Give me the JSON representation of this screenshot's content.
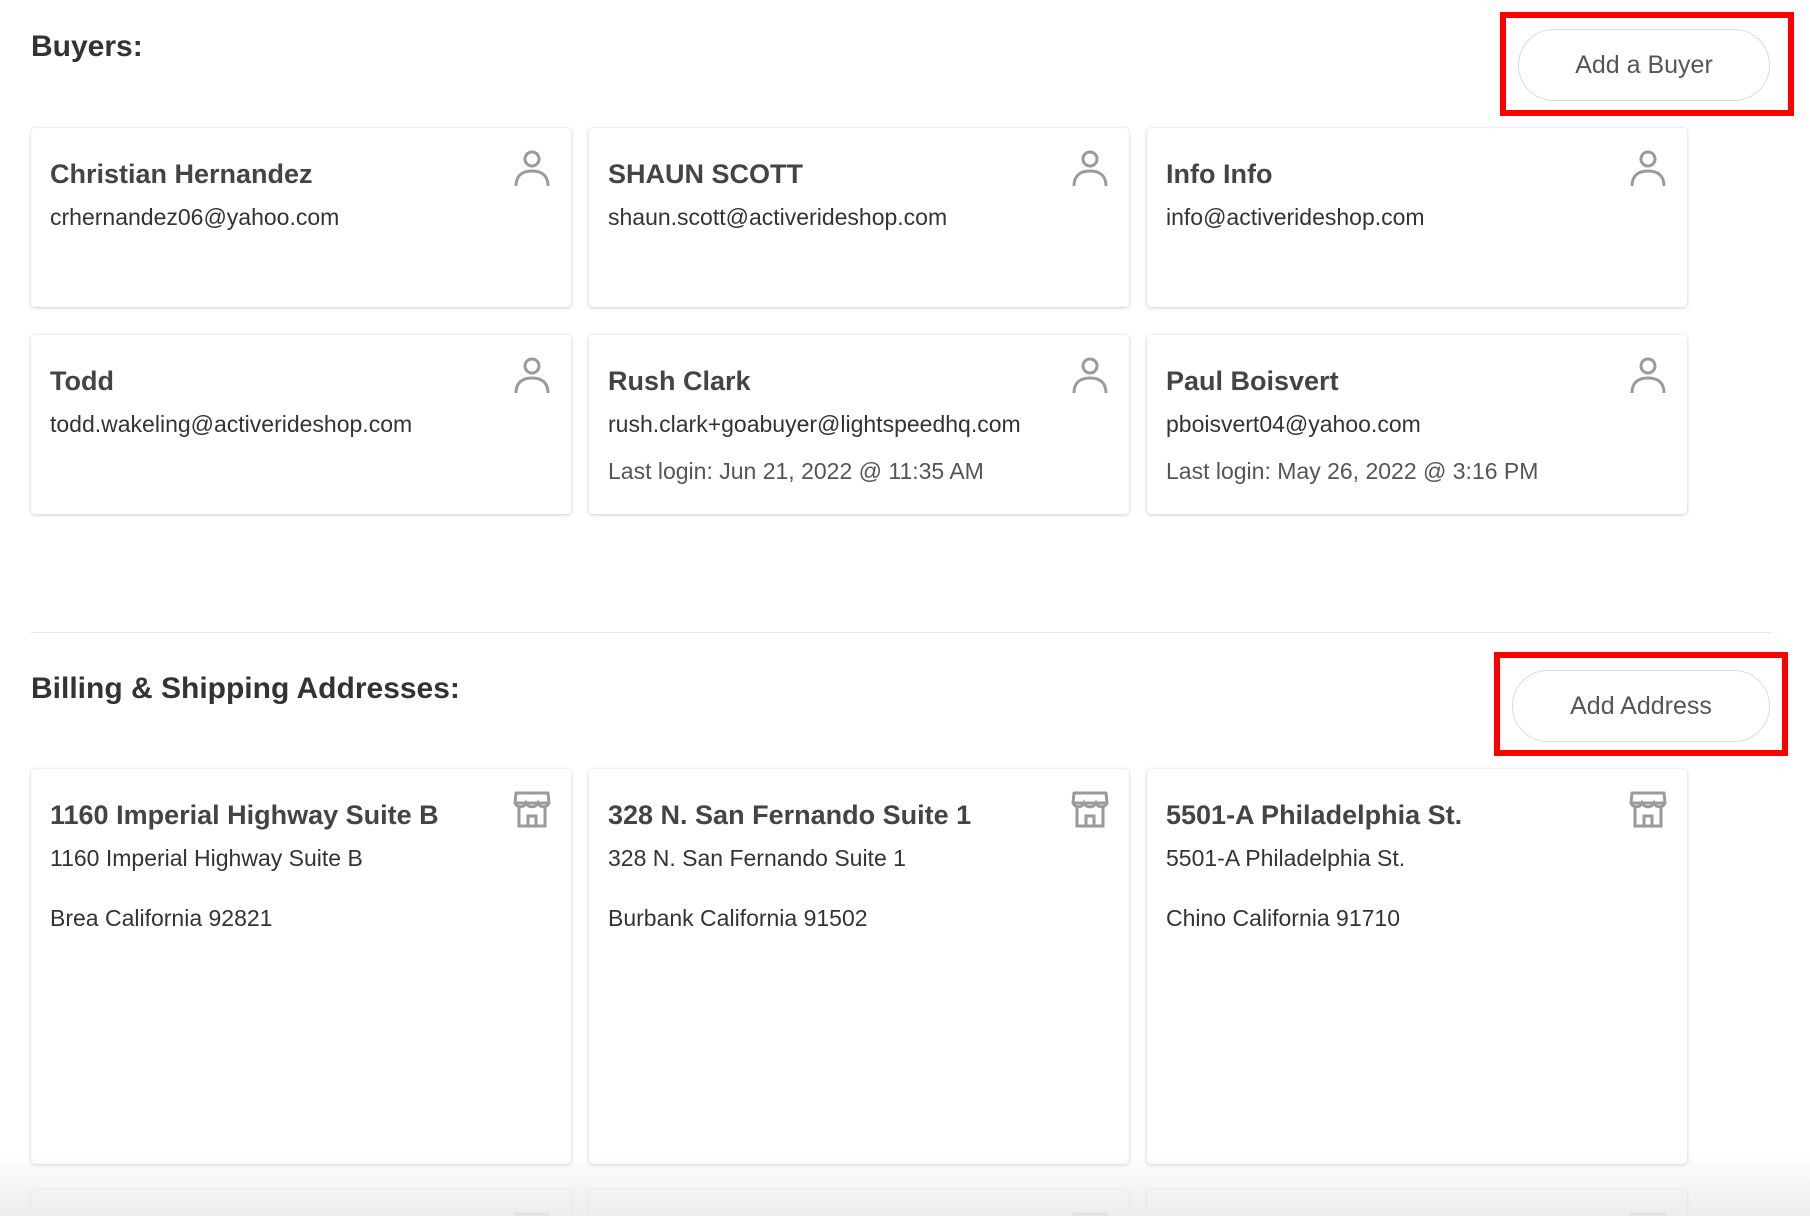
{
  "buyers_section": {
    "title": "Buyers:",
    "add_button_label": "Add a Buyer",
    "items": [
      {
        "name": "Christian Hernandez",
        "email": "crhernandez06@yahoo.com",
        "last_login": ""
      },
      {
        "name": "SHAUN SCOTT",
        "email": "shaun.scott@activerideshop.com",
        "last_login": ""
      },
      {
        "name": "Info Info",
        "email": "info@activerideshop.com",
        "last_login": ""
      },
      {
        "name": "Todd",
        "email": "todd.wakeling@activerideshop.com",
        "last_login": ""
      },
      {
        "name": "Rush Clark",
        "email": "rush.clark+goabuyer@lightspeedhq.com",
        "last_login": "Last login: Jun 21, 2022 @ 11:35 AM"
      },
      {
        "name": "Paul Boisvert",
        "email": "pboisvert04@yahoo.com",
        "last_login": "Last login: May 26, 2022 @ 3:16 PM"
      }
    ]
  },
  "addresses_section": {
    "title": "Billing & Shipping Addresses:",
    "add_button_label": "Add Address",
    "items": [
      {
        "title": "1160 Imperial Highway Suite B",
        "line1": "1160 Imperial Highway Suite B",
        "city_line": "Brea California 92821"
      },
      {
        "title": "328 N. San Fernando Suite 1",
        "line1": "328 N. San Fernando Suite 1",
        "city_line": "Burbank California 91502"
      },
      {
        "title": "5501-A Philadelphia St.",
        "line1": "5501-A Philadelphia St.",
        "city_line": "Chino California 91710"
      }
    ]
  },
  "icons": {
    "buyer_card": "user-icon",
    "address_card": "storefront-icon"
  },
  "colors": {
    "highlight": "#ff0000",
    "icon_gray": "#9a9a9a"
  }
}
